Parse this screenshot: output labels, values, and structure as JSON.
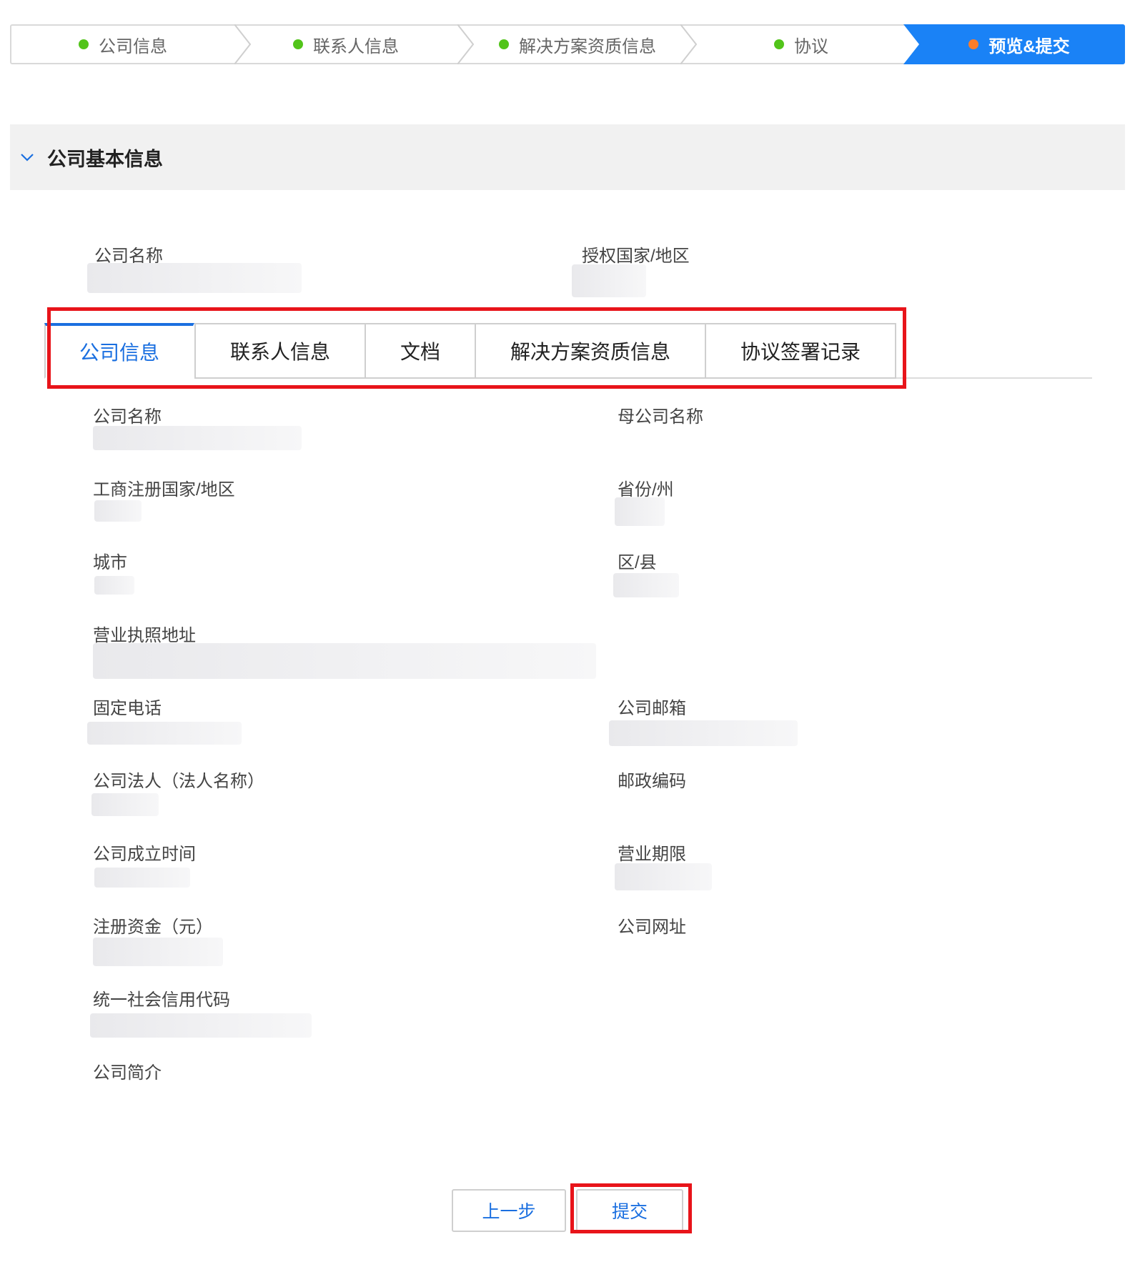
{
  "stepper": {
    "steps": [
      {
        "label": "公司信息",
        "status": "done"
      },
      {
        "label": "联系人信息",
        "status": "done"
      },
      {
        "label": "解决方案资质信息",
        "status": "done"
      },
      {
        "label": "协议",
        "status": "done"
      },
      {
        "label": "预览&提交",
        "status": "current"
      }
    ],
    "colors": {
      "done_dot": "#52c41a",
      "current_dot": "#fa7d2b",
      "current_bg": "#1a82f6"
    }
  },
  "section": {
    "title": "公司基本信息",
    "icon": "chevron-down-icon"
  },
  "summary": {
    "company_name_label": "公司名称",
    "region_label": "授权国家/地区"
  },
  "tabs": [
    {
      "label": "公司信息",
      "active": true
    },
    {
      "label": "联系人信息",
      "active": false
    },
    {
      "label": "文档",
      "active": false
    },
    {
      "label": "解决方案资质信息",
      "active": false
    },
    {
      "label": "协议签署记录",
      "active": false
    }
  ],
  "fields": {
    "company_name": "公司名称",
    "parent_company_name": "母公司名称",
    "reg_country": "工商注册国家/地区",
    "province": "省份/州",
    "city": "城市",
    "district": "区/县",
    "license_address": "营业执照地址",
    "phone": "固定电话",
    "email": "公司邮箱",
    "legal_person": "公司法人（法人名称）",
    "postal_code": "邮政编码",
    "founded": "公司成立时间",
    "business_term": "营业期限",
    "reg_capital": "注册资金（元）",
    "website": "公司网址",
    "credit_code": "统一社会信用代码",
    "intro": "公司简介"
  },
  "footer": {
    "prev_label": "上一步",
    "submit_label": "提交"
  },
  "highlight_color": "#e8141a"
}
